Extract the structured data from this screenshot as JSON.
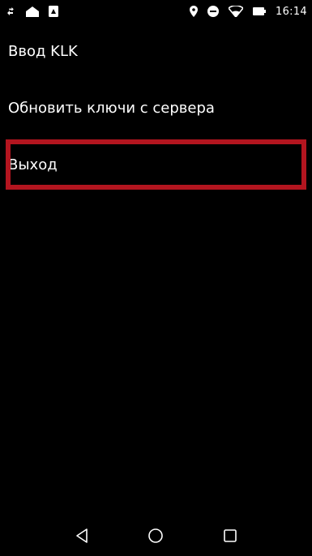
{
  "status_bar": {
    "time": "16:14",
    "icons": [
      "signal-arrows-icon",
      "home-icon",
      "sd-card-icon",
      "location-icon",
      "do-not-disturb-icon",
      "wifi-icon",
      "battery-icon"
    ]
  },
  "menu": {
    "items": [
      {
        "label": "Ввод KLK"
      },
      {
        "label": "Обновить ключи с сервера"
      },
      {
        "label": "Выход"
      }
    ],
    "highlight_color": "#b3151f"
  },
  "nav_bar": {
    "icons": [
      "back-icon",
      "home-nav-icon",
      "recents-icon"
    ]
  }
}
